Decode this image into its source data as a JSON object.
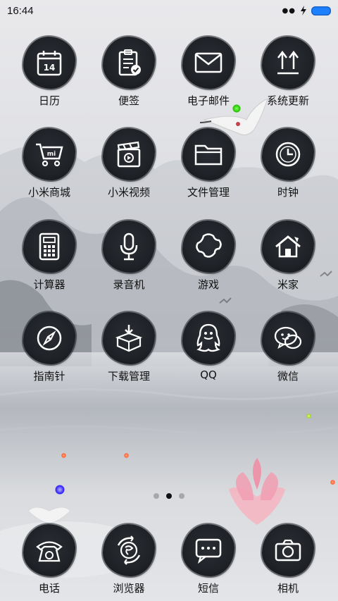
{
  "status": {
    "time": "16:44"
  },
  "apps": [
    {
      "label": "日历",
      "icon": "calendar-icon",
      "date": "14"
    },
    {
      "label": "便签",
      "icon": "notes-icon"
    },
    {
      "label": "电子邮件",
      "icon": "mail-icon"
    },
    {
      "label": "系统更新",
      "icon": "update-icon"
    },
    {
      "label": "小米商城",
      "icon": "shop-cart-icon"
    },
    {
      "label": "小米视频",
      "icon": "video-icon"
    },
    {
      "label": "文件管理",
      "icon": "folder-icon"
    },
    {
      "label": "时钟",
      "icon": "clock-icon"
    },
    {
      "label": "计算器",
      "icon": "calculator-icon"
    },
    {
      "label": "录音机",
      "icon": "microphone-icon"
    },
    {
      "label": "游戏",
      "icon": "puzzle-icon"
    },
    {
      "label": "米家",
      "icon": "home-icon"
    },
    {
      "label": "指南针",
      "icon": "compass-icon"
    },
    {
      "label": "下载管理",
      "icon": "download-box-icon"
    },
    {
      "label": "QQ",
      "icon": "qq-penguin-icon"
    },
    {
      "label": "微信",
      "icon": "wechat-icon"
    }
  ],
  "dock": [
    {
      "label": "电话",
      "icon": "phone-icon"
    },
    {
      "label": "浏览器",
      "icon": "browser-icon"
    },
    {
      "label": "短信",
      "icon": "message-icon"
    },
    {
      "label": "相机",
      "icon": "camera-icon"
    }
  ],
  "pager": {
    "pages": 3,
    "current": 2
  }
}
